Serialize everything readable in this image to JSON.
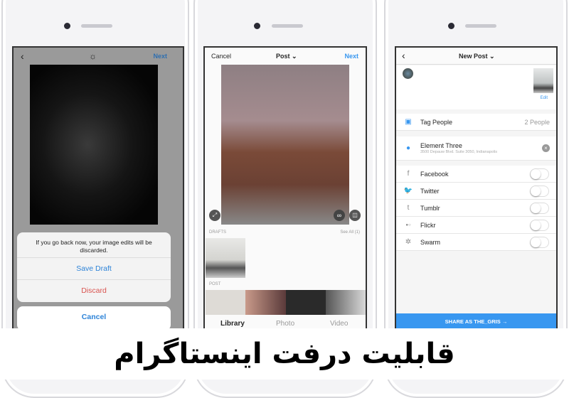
{
  "phone1": {
    "back_icon": "chevron-left-icon",
    "brightness_icon": "brightness-icon",
    "next": "Next",
    "dialog": {
      "message": "If you go back now, your image edits will be discarded.",
      "save_draft": "Save Draft",
      "discard": "Discard",
      "cancel": "Cancel"
    }
  },
  "phone2": {
    "cancel": "Cancel",
    "title": "Post ⌄",
    "next": "Next",
    "drafts_label": "DRAFTS",
    "see_all": "See All (1)",
    "post_label": "POST",
    "tabs": [
      "Library",
      "Photo",
      "Video"
    ]
  },
  "phone3": {
    "title": "New Post ⌄",
    "edit": "Edit",
    "tag_people": "Tag People",
    "tag_people_count": "2 People",
    "location_name": "Element Three",
    "location_address": "3500 Depauw Blvd. Suite 3050, Indianapolis",
    "networks": [
      {
        "label": "Facebook",
        "icon": "f",
        "enabled": false
      },
      {
        "label": "Twitter",
        "icon": "🐦",
        "enabled": false
      },
      {
        "label": "Tumblr",
        "icon": "t",
        "enabled": false
      },
      {
        "label": "Flickr",
        "icon": "●○",
        "enabled": false
      },
      {
        "label": "Swarm",
        "icon": "✲",
        "enabled": false
      }
    ],
    "share_button": "SHARE AS THE_GRIS →"
  },
  "colors": {
    "accent": "#3897f0",
    "danger": "#ed4956"
  },
  "banner": "قابلیت درفت اینستاگرام"
}
